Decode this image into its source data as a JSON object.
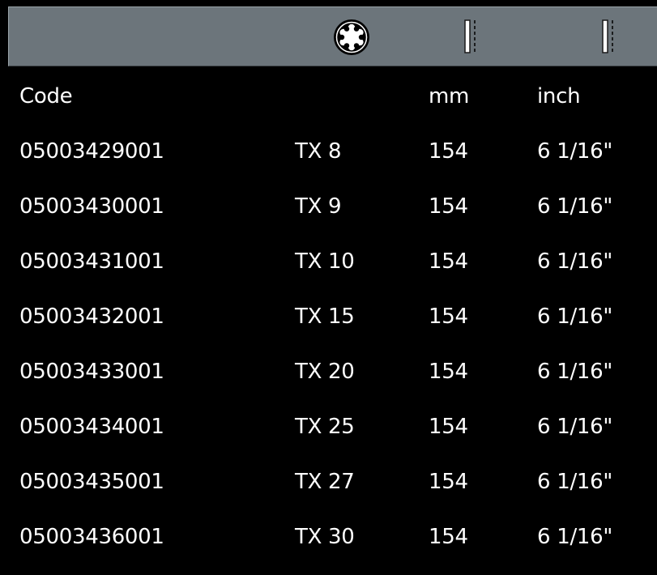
{
  "header": {
    "icons": [
      "torx-head-icon",
      "length-icon",
      "length-icon"
    ]
  },
  "columns": {
    "code": "Code",
    "size": "",
    "mm": "mm",
    "inch": "inch"
  },
  "rows": [
    {
      "code": "05003429001",
      "size": "TX 8",
      "mm": "154",
      "inch": "6 1/16\""
    },
    {
      "code": "05003430001",
      "size": "TX 9",
      "mm": "154",
      "inch": "6 1/16\""
    },
    {
      "code": "05003431001",
      "size": "TX 10",
      "mm": "154",
      "inch": "6 1/16\""
    },
    {
      "code": "05003432001",
      "size": "TX 15",
      "mm": "154",
      "inch": "6 1/16\""
    },
    {
      "code": "05003433001",
      "size": "TX 20",
      "mm": "154",
      "inch": "6 1/16\""
    },
    {
      "code": "05003434001",
      "size": "TX 25",
      "mm": "154",
      "inch": "6 1/16\""
    },
    {
      "code": "05003435001",
      "size": "TX 27",
      "mm": "154",
      "inch": "6 1/16\""
    },
    {
      "code": "05003436001",
      "size": "TX 30",
      "mm": "154",
      "inch": "6 1/16\""
    }
  ],
  "colors": {
    "background": "#000000",
    "header_bar": "#6c757b",
    "text": "#ffffff"
  }
}
